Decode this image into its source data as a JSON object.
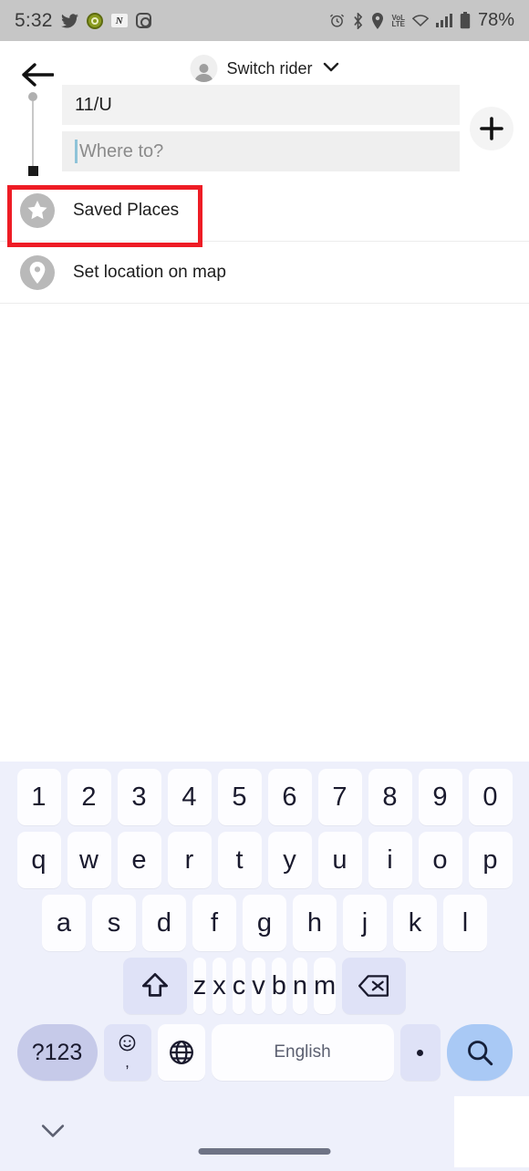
{
  "status_bar": {
    "time": "5:32",
    "battery_percent": "78%",
    "left_icons": [
      "twitter-icon",
      "app-green-icon",
      "news-n-icon",
      "instagram-icon"
    ],
    "right_icons": [
      "alarm-icon",
      "bluetooth-icon",
      "location-icon",
      "volte-icon",
      "wifi-icon",
      "signal-icon",
      "battery-icon"
    ],
    "volte_label_top": "VoL",
    "volte_label_bottom": "LTE",
    "background": "#c6c6c6"
  },
  "header": {
    "back_label": "Back",
    "switch_rider_label": "Switch rider",
    "avatar_icon": "person-icon",
    "chevron_icon": "chevron-down-icon",
    "add_stop_label": "+"
  },
  "route_fields": {
    "pickup_value": "11/U",
    "destination_value": "",
    "destination_placeholder": "Where to?"
  },
  "suggestions": [
    {
      "label": "Saved Places",
      "icon": "star-icon",
      "highlighted": true
    },
    {
      "label": "Set location on map",
      "icon": "map-pin-icon",
      "highlighted": false
    }
  ],
  "annotation": {
    "color": "#ee1c25",
    "target": "Saved Places"
  },
  "keyboard": {
    "row_numbers": [
      "1",
      "2",
      "3",
      "4",
      "5",
      "6",
      "7",
      "8",
      "9",
      "0"
    ],
    "row_top": [
      "q",
      "w",
      "e",
      "r",
      "t",
      "y",
      "u",
      "i",
      "o",
      "p"
    ],
    "row_home": [
      "a",
      "s",
      "d",
      "f",
      "g",
      "h",
      "j",
      "k",
      "l"
    ],
    "row_bottom": [
      "z",
      "x",
      "c",
      "v",
      "b",
      "n",
      "m"
    ],
    "shift_icon": "shift-icon",
    "backspace_icon": "backspace-icon",
    "symbols_label": "?123",
    "emoji_icon": "emoji-icon",
    "comma_label": ",",
    "globe_icon": "globe-icon",
    "space_label": "English",
    "period_label": ".",
    "search_icon": "search-icon",
    "hide_keyboard_icon": "chevron-down-icon",
    "accent_key_color": "#a9c9f5",
    "key_background": "#fdfdff",
    "keyboard_background": "#eef0fb"
  }
}
